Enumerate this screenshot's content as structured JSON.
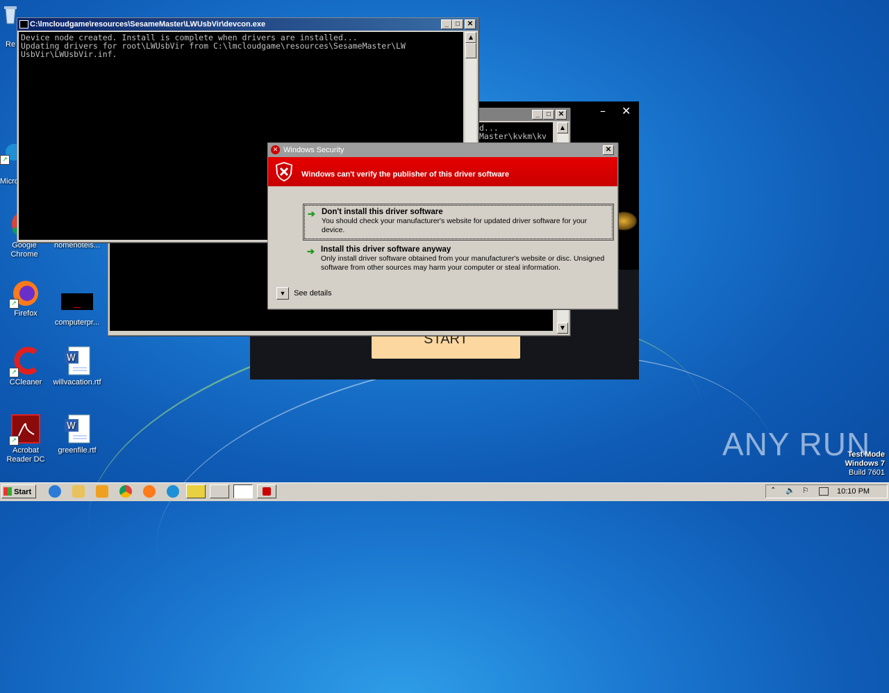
{
  "desktop": {
    "icons": [
      {
        "label": "Re",
        "id": "recycle"
      },
      {
        "label": "Micro",
        "id": "edge"
      },
      {
        "label": "Google Chrome",
        "id": "chrome"
      },
      {
        "label": "homehotels...",
        "id": "homehotels"
      },
      {
        "label": "Firefox",
        "id": "firefox"
      },
      {
        "label": "computerpr...",
        "id": "computerpr"
      },
      {
        "label": "CCleaner",
        "id": "ccleaner"
      },
      {
        "label": "willvacation.rtf",
        "id": "willvacation"
      },
      {
        "label": "Acrobat Reader DC",
        "id": "acrobat"
      },
      {
        "label": "greenfile.rtf",
        "id": "greenfile"
      }
    ],
    "watermark": "ANY RUN",
    "test_mode": {
      "line1": "Test Mode",
      "line2": "Windows 7",
      "line3": "Build 7601"
    }
  },
  "console_main": {
    "title": "C:\\lmcloudgame\\resources\\SesameMaster\\LWUsbVir\\devcon.exe",
    "output": "Device node created. Install is complete when drivers are installed...\nUpdating drivers for root\\LWUsbVir from C:\\lmcloudgame\\resources\\SesameMaster\\LW\nUsbVir\\LWUsbVir.inf."
  },
  "console_back": {
    "output": "d...\nMaster\\kvkm\\kv"
  },
  "game_window": {
    "start_label": "START"
  },
  "security_dialog": {
    "title": "Windows Security",
    "headline": "Windows can't verify the publisher of this driver software",
    "option1": {
      "heading": "Don't install this driver software",
      "desc": "You should check your manufacturer's website for updated driver software for your device."
    },
    "option2": {
      "heading": "Install this driver software anyway",
      "desc": "Only install driver software obtained from your manufacturer's website or disc. Unsigned software from other sources may harm your computer or steal information."
    },
    "details_label": "See details"
  },
  "taskbar": {
    "start_label": "Start",
    "clock": "10:10 PM"
  },
  "colors": {
    "accent_red": "#d00000",
    "titlebar_active": "#0a246a",
    "arrow_green": "#1a9a1a"
  }
}
